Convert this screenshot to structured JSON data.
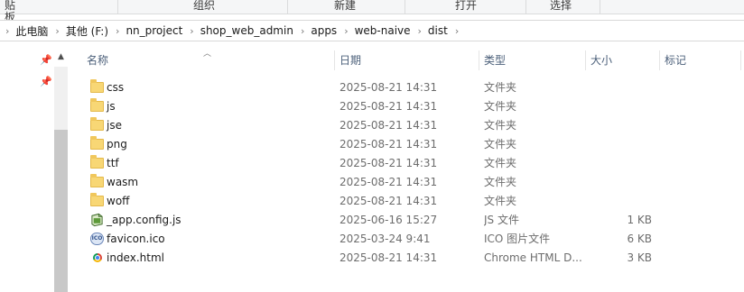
{
  "ribbon": {
    "groups": [
      "贴板",
      "组织",
      "新建",
      "打开",
      "选择"
    ]
  },
  "address": {
    "crumbs": [
      "此电脑",
      "其他 (F:)",
      "nn_project",
      "shop_web_admin",
      "apps",
      "web-naive",
      "dist"
    ]
  },
  "columns": {
    "name": "名称",
    "date": "日期",
    "type": "类型",
    "size": "大小",
    "tags": "标记"
  },
  "files": [
    {
      "name": "css",
      "date": "2025-08-21 14:31",
      "type": "文件夹",
      "size": "",
      "icon": "folder-icon"
    },
    {
      "name": "js",
      "date": "2025-08-21 14:31",
      "type": "文件夹",
      "size": "",
      "icon": "folder-icon"
    },
    {
      "name": "jse",
      "date": "2025-08-21 14:31",
      "type": "文件夹",
      "size": "",
      "icon": "folder-icon"
    },
    {
      "name": "png",
      "date": "2025-08-21 14:31",
      "type": "文件夹",
      "size": "",
      "icon": "folder-icon"
    },
    {
      "name": "ttf",
      "date": "2025-08-21 14:31",
      "type": "文件夹",
      "size": "",
      "icon": "folder-icon"
    },
    {
      "name": "wasm",
      "date": "2025-08-21 14:31",
      "type": "文件夹",
      "size": "",
      "icon": "folder-icon"
    },
    {
      "name": "woff",
      "date": "2025-08-21 14:31",
      "type": "文件夹",
      "size": "",
      "icon": "folder-icon"
    },
    {
      "name": "_app.config.js",
      "date": "2025-06-16 15:27",
      "type": "JS 文件",
      "size": "1 KB",
      "icon": "js-file-icon"
    },
    {
      "name": "favicon.ico",
      "date": "2025-03-24 9:41",
      "type": "ICO 图片文件",
      "size": "6 KB",
      "icon": "ico-file-icon"
    },
    {
      "name": "index.html",
      "date": "2025-08-21 14:31",
      "type": "Chrome HTML D...",
      "size": "3 KB",
      "icon": "chrome-html-icon"
    }
  ]
}
